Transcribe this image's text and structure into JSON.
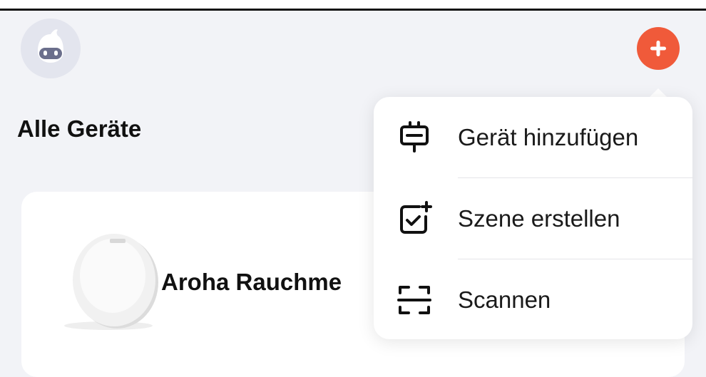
{
  "header": {
    "avatar_icon": "robot-avatar-icon",
    "add_icon": "plus-icon",
    "accent_color": "#f05a3a"
  },
  "main": {
    "title": "Alle Geräte",
    "devices": [
      {
        "name": "Aroha Rauchme",
        "image": "smoke-detector-image"
      }
    ]
  },
  "menu": {
    "items": [
      {
        "label": "Gerät hinzufügen",
        "icon": "add-device-icon"
      },
      {
        "label": "Szene erstellen",
        "icon": "create-scene-icon"
      },
      {
        "label": "Scannen",
        "icon": "scan-icon"
      }
    ]
  }
}
